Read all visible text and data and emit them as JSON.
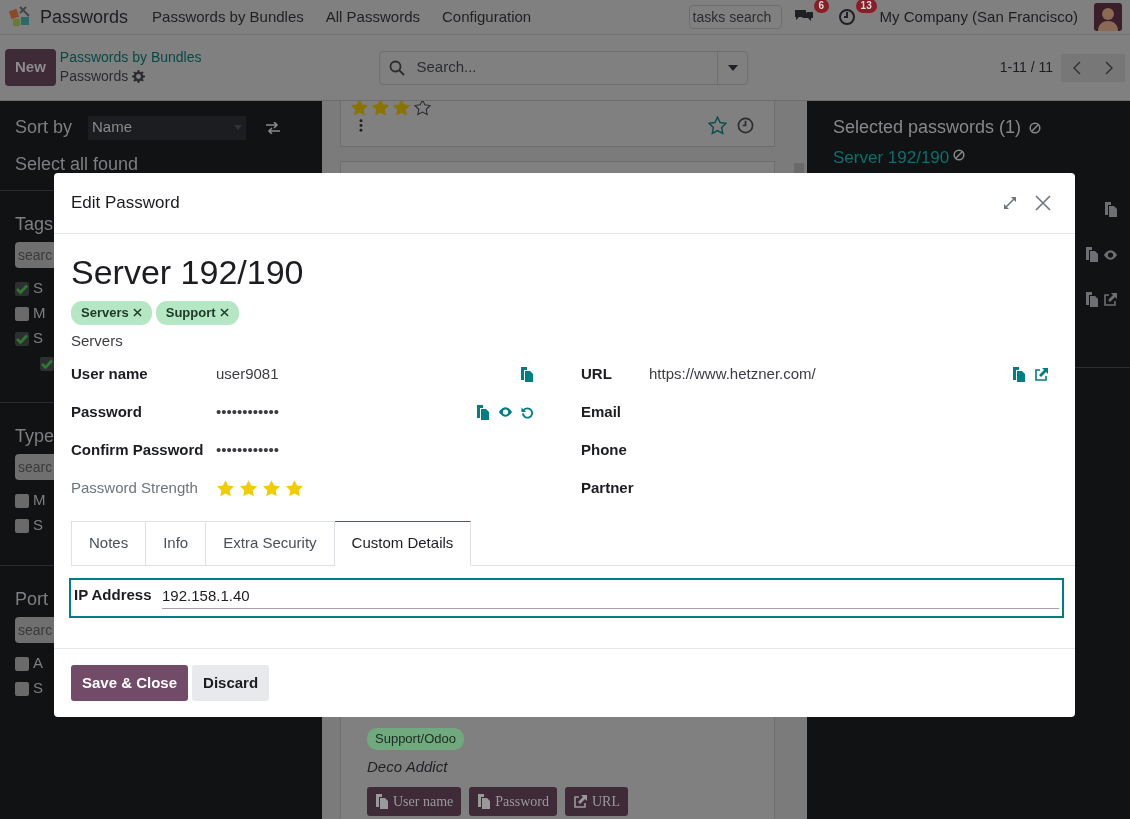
{
  "navbar": {
    "app_name": "Passwords",
    "menu": [
      "Passwords by Bundles",
      "All Passwords",
      "Configuration"
    ],
    "tasks_search": {
      "placeholder": "tasks search"
    },
    "messages_count": "6",
    "activities_count": "13",
    "company": "My Company (San Francisco)"
  },
  "control_panel": {
    "new_button": "New",
    "breadcrumb": "Passwords by Bundles",
    "current": "Passwords",
    "search": {
      "placeholder": "Search..."
    },
    "pager": "1-11 / 11"
  },
  "sidebar": {
    "sort_label": "Sort by",
    "sort_value": "Name",
    "select_all": "Select all found",
    "filters": [
      {
        "title": "Tags",
        "search_placeholder": "searc",
        "options": [
          {
            "label": "S",
            "checked": true
          },
          {
            "label": "M",
            "checked": false
          },
          {
            "label": "S",
            "checked": true,
            "children": [
              {
                "checked": true
              }
            ]
          }
        ]
      },
      {
        "title": "Type",
        "search_placeholder": "searc",
        "options": [
          {
            "label": "M",
            "checked": false
          },
          {
            "label": "S",
            "checked": false
          }
        ]
      },
      {
        "title": "Port",
        "search_placeholder": "searc",
        "options": [
          {
            "label": "A",
            "checked": false
          },
          {
            "label": "S",
            "checked": false
          }
        ]
      }
    ]
  },
  "kanban": {
    "cards": [
      {
        "kind": "rated",
        "stars": 3
      },
      {
        "kind": "hidden"
      },
      {
        "kind": "detail",
        "tag": {
          "label": "Support/Odoo",
          "color": "#6fa97d"
        },
        "partner": "Deco Addict",
        "buttons": [
          {
            "label": "User name",
            "kind": "copy"
          },
          {
            "label": "Password",
            "kind": "copy"
          },
          {
            "label": "URL",
            "kind": "open"
          }
        ]
      }
    ]
  },
  "selection_panel": {
    "title": "Selected passwords (1)",
    "items": [
      "Server 192/190"
    ],
    "rows": [
      {
        "actions": [
          {
            "kind": "copy"
          }
        ]
      },
      {
        "actions": [
          {
            "kind": "copy"
          },
          {
            "kind": "show"
          }
        ]
      },
      {
        "actions": [
          {
            "kind": "copy"
          },
          {
            "kind": "open"
          }
        ]
      }
    ]
  },
  "dialog": {
    "title": "Edit Password",
    "name": "Server 192/190",
    "tags": [
      "Servers",
      "Support"
    ],
    "bundle": "Servers",
    "fields_left": [
      {
        "label": "User name",
        "kind": "text",
        "value": "user9081",
        "actions": [
          {
            "kind": "copy"
          }
        ]
      },
      {
        "label": "Password",
        "kind": "text",
        "value": "••••••••••••",
        "actions": [
          {
            "kind": "copy"
          },
          {
            "kind": "show"
          },
          {
            "kind": "generate"
          }
        ]
      },
      {
        "label": "Confirm Password",
        "kind": "text",
        "value": "••••••••••••"
      },
      {
        "label": "Password Strength",
        "kind": "stars",
        "stars": 4
      }
    ],
    "fields_right": [
      {
        "label": "URL",
        "kind": "text",
        "value": "https://www.hetzner.com/",
        "actions": [
          {
            "kind": "copy"
          },
          {
            "kind": "open"
          }
        ]
      },
      {
        "label": "Email"
      },
      {
        "label": "Phone"
      },
      {
        "label": "Partner"
      }
    ],
    "tabs": [
      {
        "label": "Notes",
        "selected": false
      },
      {
        "label": "Info",
        "selected": false
      },
      {
        "label": "Extra Security",
        "selected": false
      },
      {
        "label": "Custom Details",
        "selected": true
      }
    ],
    "custom_fields": [
      {
        "label": "IP Address",
        "value": "192.158.1.40",
        "focused": true
      }
    ],
    "buttons": [
      {
        "label": "Save & Close",
        "kind": "primary"
      },
      {
        "label": "Discard",
        "kind": "secondary"
      }
    ]
  }
}
